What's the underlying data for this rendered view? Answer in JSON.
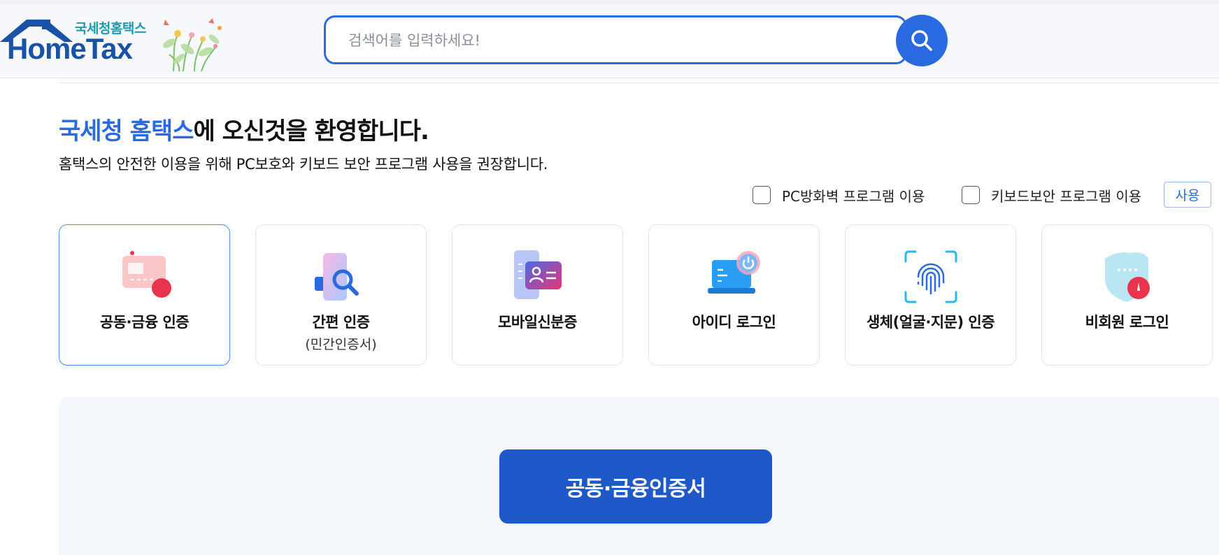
{
  "header": {
    "logo_sub": "국세청홈택스",
    "logo_main": "HomeTax",
    "search_placeholder": "검색어를 입력하세요!"
  },
  "welcome": {
    "highlight": "국세청 홈택스",
    "rest": "에 오신것을 환영합니다.",
    "subline": "홈택스의 안전한 이용을 위해 PC보호와 키보드 보안 프로그램 사용을 권장합니다."
  },
  "options": {
    "firewall_label": "PC방화벽 프로그램 이용",
    "keyboard_label": "키보드보안 프로그램 이용",
    "use_button": "사용"
  },
  "login_methods": [
    {
      "label": "공동·금융 인증",
      "sublabel": "",
      "icon": "certificate-icon",
      "active": true
    },
    {
      "label": "간편 인증",
      "sublabel": "(민간인증서)",
      "icon": "simple-auth-icon",
      "active": false
    },
    {
      "label": "모바일신분증",
      "sublabel": "",
      "icon": "mobile-id-icon",
      "active": false
    },
    {
      "label": "아이디 로그인",
      "sublabel": "",
      "icon": "laptop-login-icon",
      "active": false
    },
    {
      "label": "생체(얼굴·지문) 인증",
      "sublabel": "",
      "icon": "fingerprint-icon",
      "active": false
    },
    {
      "label": "비회원 로그인",
      "sublabel": "",
      "icon": "guest-shield-icon",
      "active": false
    }
  ],
  "panel": {
    "main_button": "공동·금융인증서"
  },
  "colors": {
    "brand_blue": "#2a6ae0",
    "button_blue": "#1f58c9",
    "logo_teal": "#1f9aa8",
    "logo_navy": "#1a52a8",
    "panel_bg": "#f3f6fa"
  }
}
